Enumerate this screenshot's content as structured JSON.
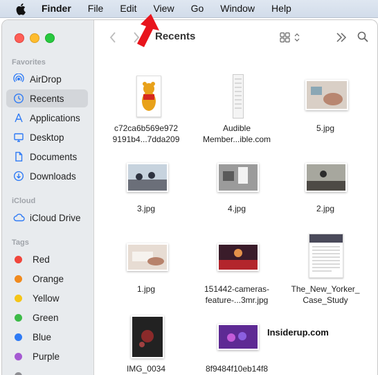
{
  "menubar": {
    "app": "Finder",
    "items": [
      "File",
      "Edit",
      "View",
      "Go",
      "Window",
      "Help"
    ]
  },
  "toolbar": {
    "title": "Recents"
  },
  "sidebar": {
    "favorites_title": "Favorites",
    "favorites": [
      "AirDrop",
      "Recents",
      "Applications",
      "Desktop",
      "Documents",
      "Downloads"
    ],
    "icloud_title": "iCloud",
    "icloud": [
      "iCloud Drive"
    ],
    "tags_title": "Tags",
    "tags": [
      {
        "label": "Red",
        "color": "#f0463c"
      },
      {
        "label": "Orange",
        "color": "#f08a1e"
      },
      {
        "label": "Yellow",
        "color": "#f5c518"
      },
      {
        "label": "Green",
        "color": "#3dbb48"
      },
      {
        "label": "Blue",
        "color": "#2f7bf5"
      },
      {
        "label": "Purple",
        "color": "#a55ad2"
      }
    ]
  },
  "files": [
    {
      "line1": "c72ca6b569e972",
      "line2": "9191b4...7dda209"
    },
    {
      "line1": "Audible",
      "line2": "Member...ible.com"
    },
    {
      "line1": "5.jpg",
      "line2": ""
    },
    {
      "line1": "3.jpg",
      "line2": ""
    },
    {
      "line1": "4.jpg",
      "line2": ""
    },
    {
      "line1": "2.jpg",
      "line2": ""
    },
    {
      "line1": "1.jpg",
      "line2": ""
    },
    {
      "line1": "151442-cameras-",
      "line2": "feature-...3mr.jpg"
    },
    {
      "line1": "The_New_Yorker_",
      "line2": "Case_Study"
    },
    {
      "line1": "IMG_0034",
      "line2": ""
    },
    {
      "line1": "8f9484f10eb14f8",
      "line2": ""
    }
  ],
  "watermark": "Insiderup.com",
  "colors": {
    "accent": "#2f7bf5",
    "arrow": "#e8141c"
  }
}
